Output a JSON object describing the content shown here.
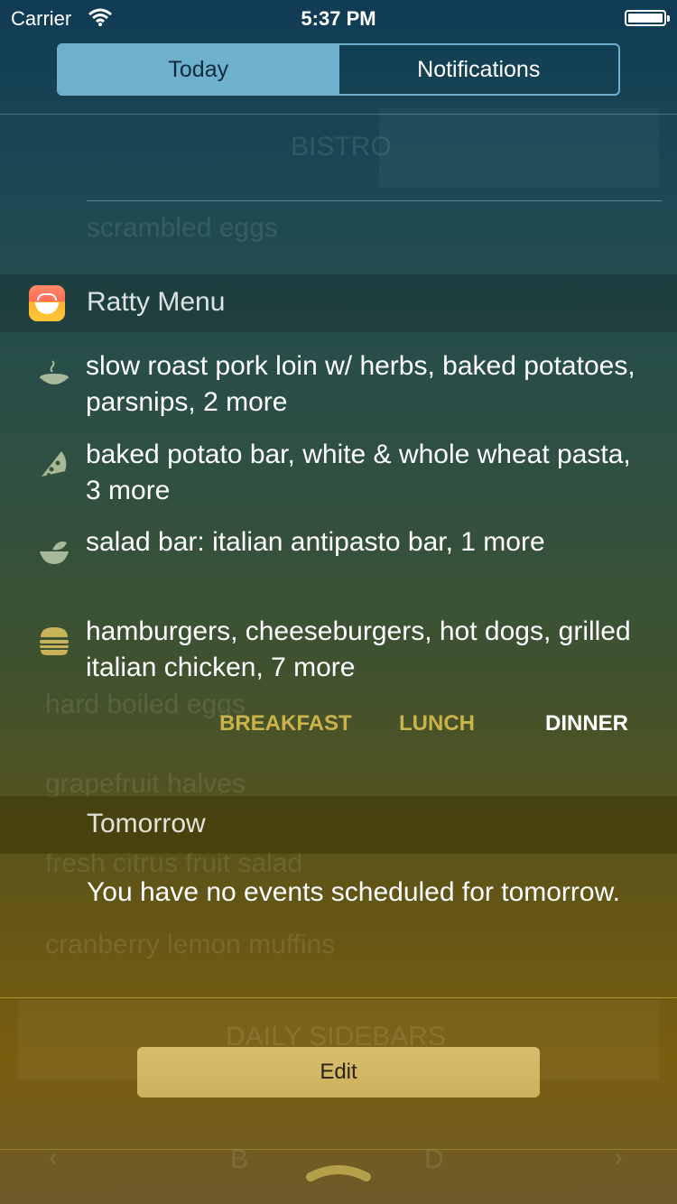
{
  "status_bar": {
    "carrier": "Carrier",
    "time": "5:37 PM"
  },
  "segmented": {
    "today": "Today",
    "notifications": "Notifications"
  },
  "widget": {
    "title": "Ratty Menu",
    "items": [
      {
        "icon": "soup-bowl-icon",
        "text": "slow roast pork loin w/ herbs, baked potatoes, parsnips, 2 more"
      },
      {
        "icon": "pizza-slice-icon",
        "text": "baked potato bar, white & whole wheat pasta, 3 more"
      },
      {
        "icon": "salad-bowl-icon",
        "text": "salad bar: italian antipasto bar, 1 more"
      },
      {
        "icon": "burger-icon",
        "text": "hamburgers, cheeseburgers, hot dogs, grilled italian chicken, 7 more"
      }
    ],
    "meals": {
      "breakfast": "BREAKFAST",
      "lunch": "LUNCH",
      "dinner": "DINNER",
      "active": "DINNER"
    }
  },
  "tomorrow": {
    "title": "Tomorrow",
    "message": "You have no events scheduled for tomorrow."
  },
  "edit_label": "Edit",
  "colors": {
    "accent": "#6fb0cf",
    "meal_inactive": "#cbb24a",
    "edit_button": "#d7bd6c"
  }
}
